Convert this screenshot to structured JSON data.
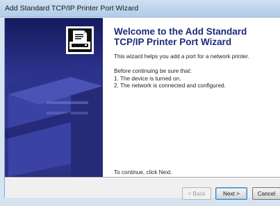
{
  "window": {
    "title": "Add Standard TCP/IP Printer Port Wizard"
  },
  "page": {
    "heading": "Welcome to the Add Standard TCP/IP Printer Port Wizard",
    "intro": "This wizard helps you add a port for a network printer.",
    "prereq_title": "Before continuing be sure that:",
    "prereq_items": [
      "1. The device is turned on.",
      "2. The network is connected and configured."
    ],
    "continue_hint": "To continue, click Next."
  },
  "buttons": {
    "back": "< Back",
    "next": "Next >",
    "cancel": "Cancel"
  },
  "colors": {
    "banner": "#2f3793",
    "heading": "#1a2a7a"
  },
  "icons": {
    "banner_art": "printer-illustration",
    "wizard_icon": "printer-document-icon"
  }
}
